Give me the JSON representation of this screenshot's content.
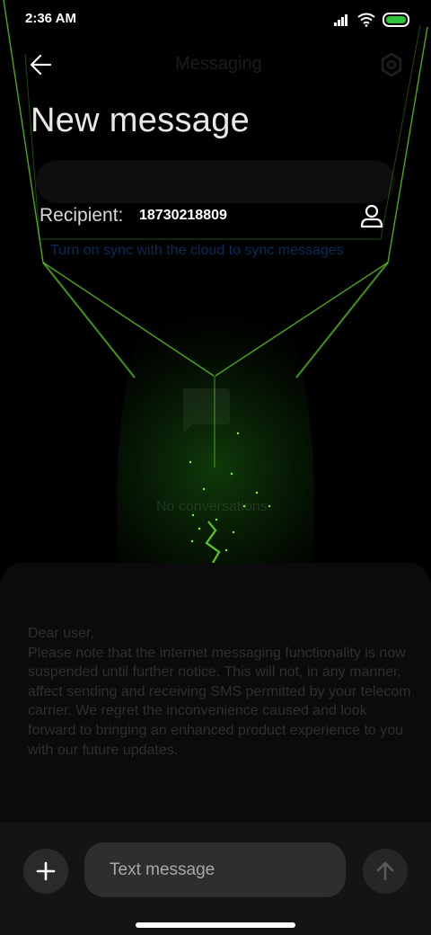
{
  "status_bar": {
    "time": "2:36 AM"
  },
  "header": {
    "title": "New message",
    "ghost_title": "Messaging"
  },
  "recipient": {
    "label": "Recipient:",
    "value": "18730218809"
  },
  "background_screen": {
    "sync_text": "Turn on sync with the cloud to sync messages",
    "empty_text": "No conversations"
  },
  "notice": {
    "text": "Dear user,\nPlease note that the internet messaging functionality is now suspended until further notice. This will not, in any manner, affect sending and receiving SMS permitted by your telecom carrier. We regret the inconvenience caused and look forward to bringing an enhanced product experience to you with our future updates."
  },
  "composer": {
    "placeholder": "Text message"
  },
  "colors": {
    "accent_green": "#7CFC2A",
    "battery": "#2ec33b",
    "background": "#000000"
  },
  "icons": [
    "signal-icon",
    "wifi-icon",
    "battery-icon",
    "back-arrow-icon",
    "person-icon",
    "plus-icon",
    "send-arrow-icon",
    "gear-icon",
    "chat-bubble-icon"
  ]
}
